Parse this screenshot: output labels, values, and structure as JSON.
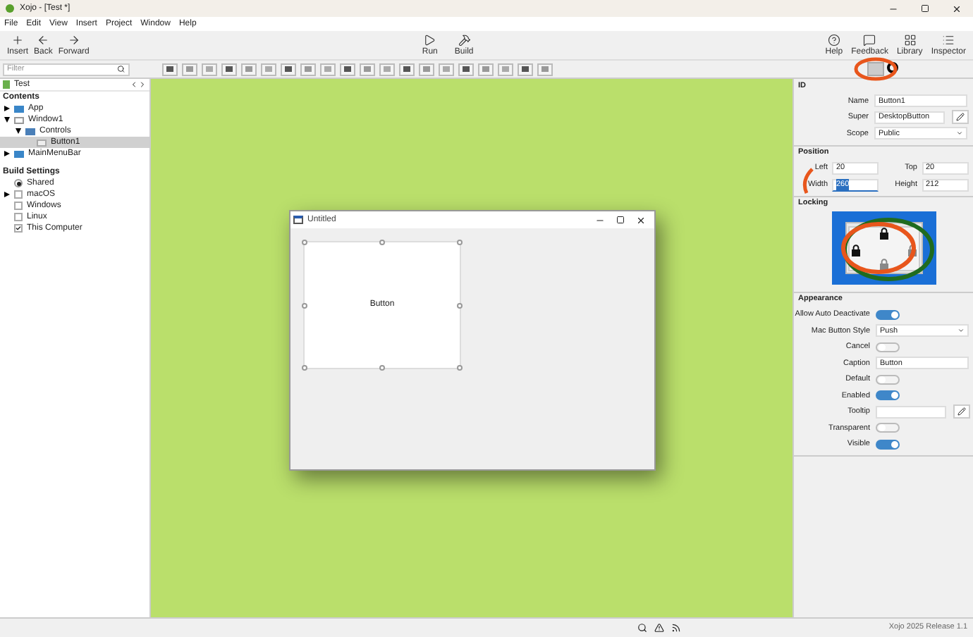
{
  "window": {
    "title": "Xojo - [Test *]"
  },
  "menu": [
    "File",
    "Edit",
    "View",
    "Insert",
    "Project",
    "Window",
    "Help"
  ],
  "toolbar_left": [
    {
      "label": "Insert"
    },
    {
      "label": "Back"
    },
    {
      "label": "Forward"
    }
  ],
  "toolbar_center": [
    {
      "label": "Run"
    },
    {
      "label": "Build"
    }
  ],
  "toolbar_right": [
    {
      "label": "Help"
    },
    {
      "label": "Feedback"
    },
    {
      "label": "Library"
    },
    {
      "label": "Inspector"
    }
  ],
  "filter": {
    "placeholder": "Filter"
  },
  "navigator": {
    "title": "Test",
    "contents_heading": "Contents",
    "items": [
      {
        "label": "App",
        "kind": "app",
        "expanded": false,
        "selected": false
      },
      {
        "label": "Window1",
        "kind": "window",
        "expanded": true,
        "selected": false,
        "children": [
          {
            "label": "Controls",
            "kind": "controls",
            "expanded": true,
            "selected": false,
            "children": [
              {
                "label": "Button1",
                "kind": "button",
                "selected": true
              }
            ]
          }
        ]
      },
      {
        "label": "MainMenuBar",
        "kind": "menubar",
        "expanded": false,
        "selected": false
      }
    ],
    "build_heading": "Build Settings",
    "build_items": [
      {
        "label": "Shared",
        "kind": "radio",
        "checked": true,
        "expandable": false
      },
      {
        "label": "macOS",
        "kind": "checkbox",
        "checked": false,
        "expandable": true
      },
      {
        "label": "Windows",
        "kind": "checkbox",
        "checked": false,
        "expandable": false
      },
      {
        "label": "Linux",
        "kind": "checkbox",
        "checked": false,
        "expandable": false
      },
      {
        "label": "This Computer",
        "kind": "checkbox",
        "checked": true,
        "expandable": false
      }
    ]
  },
  "layout_window": {
    "title": "Untitled",
    "button": {
      "caption": "Button"
    }
  },
  "inspector": {
    "id": {
      "heading": "ID",
      "rows": [
        {
          "label": "Name",
          "kind": "text",
          "value": "Button1",
          "pen": false
        },
        {
          "label": "Super",
          "kind": "text",
          "value": "DesktopButton",
          "pen": true
        },
        {
          "label": "Scope",
          "kind": "select",
          "value": "Public"
        }
      ]
    },
    "position": {
      "heading": "Position",
      "fields": [
        {
          "label": "Left",
          "value": "20",
          "selected": false
        },
        {
          "label": "Top",
          "value": "20",
          "selected": false
        },
        {
          "label": "Width",
          "value": "260",
          "selected": true
        },
        {
          "label": "Height",
          "value": "212",
          "selected": false
        }
      ]
    },
    "locking": {
      "heading": "Locking"
    },
    "appearance": {
      "heading": "Appearance",
      "rows": [
        {
          "label": "Allow Auto Deactivate",
          "kind": "switch",
          "on": true
        },
        {
          "label": "Mac Button Style",
          "kind": "select",
          "value": "Push"
        },
        {
          "label": "Cancel",
          "kind": "switch",
          "on": false
        },
        {
          "label": "Caption",
          "kind": "text",
          "value": "Button",
          "pen": false
        },
        {
          "label": "Default",
          "kind": "switch",
          "on": false
        },
        {
          "label": "Enabled",
          "kind": "switch",
          "on": true
        },
        {
          "label": "Tooltip",
          "kind": "text",
          "pen": true
        },
        {
          "label": "Transparent",
          "kind": "switch",
          "on": false
        },
        {
          "label": "Visible",
          "kind": "switch",
          "on": true
        }
      ]
    }
  },
  "status_bar": {
    "version": "Xojo 2025 Release 1.1"
  }
}
